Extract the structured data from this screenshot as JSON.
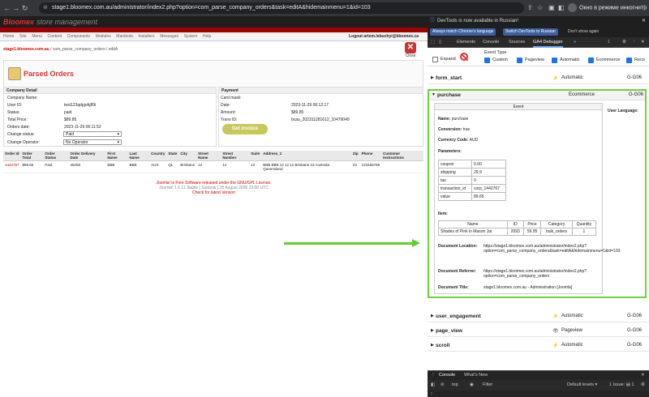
{
  "browser": {
    "url": "stage1.bloomex.com.au/administrator/index2.php?option=com_parse_company_orders&task=editA&hidemainmenu=1&id=103",
    "incognito_label": "Окно в режиме инкогнито"
  },
  "site": {
    "logo": "Bloomex",
    "logo_sub": "store management",
    "menu": [
      "Home",
      "Site",
      "Menu",
      "Content",
      "Components",
      "Modules",
      "Mambots",
      "Installers",
      "Messages",
      "System",
      "Help"
    ],
    "logout": "Logout artem.lebuchyi@bloomex.ca",
    "breadcrumb_site": "stage1.bloomex.com.au",
    "breadcrumb_path": "/ com_parse_company_orders / editA",
    "close_label": "Close",
    "page_title": "Parsed Orders"
  },
  "company": {
    "header": "Company Detail",
    "rows": [
      {
        "k": "Company Name:",
        "v": ""
      },
      {
        "k": "User ID:",
        "v": "test123qdpjohj89i"
      },
      {
        "k": "Status:",
        "v": "paid"
      },
      {
        "k": "Total Price:",
        "v": "$89.85"
      },
      {
        "k": "Orders date:",
        "v": "2023-11-29 06:11:52"
      },
      {
        "k": "Change status:",
        "v": ""
      },
      {
        "k": "Change Operator:",
        "v": ""
      }
    ],
    "status_select": "Paid",
    "operator_select": "No Operator"
  },
  "payment": {
    "header": "Payment",
    "rows": [
      {
        "k": "Card mask:",
        "v": ""
      },
      {
        "k": "Date:",
        "v": "2023-11-29 06:12:17"
      },
      {
        "k": "Amount:",
        "v": "$89.85"
      },
      {
        "k": "Trans ID:",
        "v": "bcau_202311281612_10479049"
      }
    ],
    "button": "Get invoice"
  },
  "orders": {
    "headers": [
      "Order Id",
      "Order Total",
      "Order Status",
      "Order Delivery Date",
      "First Name",
      "Last Name",
      "Country",
      "State",
      "City",
      "Street Name",
      "Street Number",
      "Suite",
      "Address_1",
      "Zip",
      "Phone",
      "Customer Instructions"
    ],
    "rows": [
      [
        "1442767",
        "$89.65",
        "Paid",
        "45258",
        "BBB",
        "BBB",
        "AUS",
        "QL",
        "Brisbane",
        "12",
        "12",
        "12",
        "BBB BBB 12 12 12 Brisbane 23 Australia Queensland",
        "23",
        "123456789",
        ""
      ]
    ]
  },
  "footer": {
    "line1": "Joomla! is Free Software released under the GNU/GPL License.",
    "line2": "Joomla! 1.0.11 Stable [ Sunbow ] 28 August 2006 23:00 UTC",
    "line3": "Check for latest Version"
  },
  "devtools": {
    "info": "DevTools is now available in Russian!",
    "btn1": "Always match Chrome's language",
    "btn2": "Switch DevTools to Russian",
    "btn3": "Don't show again",
    "tabs": [
      "Elements",
      "Console",
      "Sources",
      "GA4 Debugger"
    ],
    "badge": "1",
    "event_type_label": "Event Type",
    "expand_label": "Expand",
    "filters": [
      "Custom",
      "Pageview",
      "Automatic",
      "Ecommerce",
      "Reco"
    ],
    "events": [
      {
        "name": "form_start",
        "type": "Automatic",
        "id": "G-G06"
      },
      {
        "name": "purchase",
        "type": "Ecommerce",
        "id": "G-G06"
      },
      {
        "name": "user_engagement",
        "type": "Automatic",
        "id": "G-G06"
      },
      {
        "name": "page_view",
        "type": "Pageview",
        "id": "G-G06"
      },
      {
        "name": "scroll",
        "type": "Automatic",
        "id": "G-G06"
      }
    ],
    "event_box_header": "Event",
    "name_k": "Name:",
    "name_v": "purchase",
    "conv_k": "Conversion:",
    "conv_v": "true",
    "cur_k": "Currency Code:",
    "cur_v": "AUD",
    "params_label": "Parameters:",
    "params": [
      [
        "coupon",
        "0.00"
      ],
      [
        "shipping",
        "29.9"
      ],
      [
        "tax",
        "0"
      ],
      [
        "transaction_id",
        "corp_1442767"
      ],
      [
        "value",
        "89.65"
      ]
    ],
    "item_label": "Item:",
    "item_headers": [
      "Name",
      "ID",
      "Price",
      "Category",
      "Quantity"
    ],
    "items": [
      [
        "Shades of Pink in Mason Jar",
        "2093",
        "59.95",
        "bulk_orders",
        "1"
      ]
    ],
    "doc_loc_k": "Document Location:",
    "doc_loc_v": "https://stage1.bloomex.com.au/administrator/index2.php?option=com_parse_company_orders&task=editA&hidemainmenu=1&id=103",
    "doc_ref_k": "Document Referrer:",
    "doc_ref_v": "https://stage1.bloomex.com.au/administrator/index2.php?option=com_parse_company_orders",
    "doc_title_k": "Document Title:",
    "doc_title_v": "stage1.bloomex.com.au - Administration [Joomla]",
    "user_lang": "User Language:",
    "console_tabs": [
      "Console",
      "What's New"
    ],
    "console_top": "top",
    "console_filter": "Filter",
    "console_levels": "Default levels ▾",
    "console_issues": "1 Issue: ▤ 1"
  }
}
